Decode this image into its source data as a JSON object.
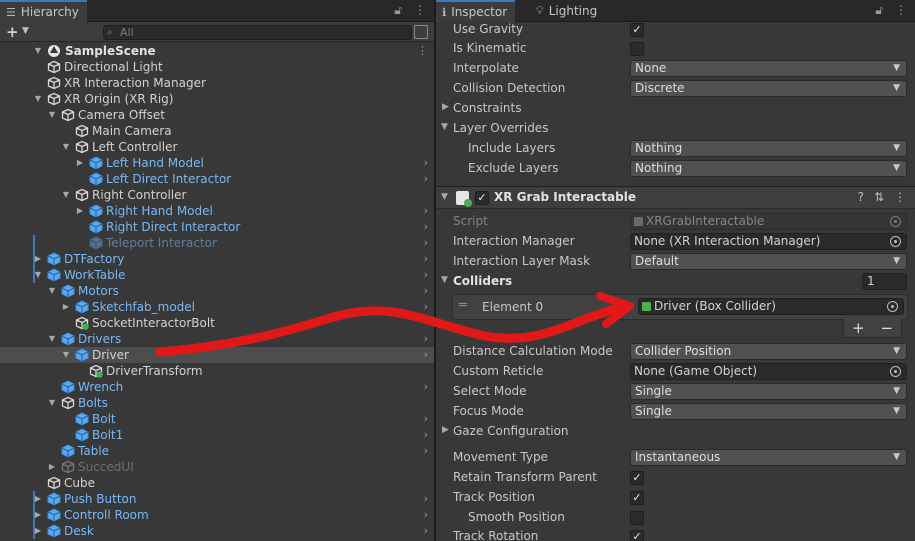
{
  "hierarchy": {
    "tab_label": "Hierarchy",
    "search_placeholder": "All",
    "scene_name": "SampleScene",
    "rows": [
      {
        "label": "Directional Light",
        "color": "white"
      },
      {
        "label": "XR Interaction Manager",
        "color": "white"
      },
      {
        "label": "XR Origin (XR Rig)",
        "color": "white"
      },
      {
        "label": "Camera Offset",
        "color": "white"
      },
      {
        "label": "Main Camera",
        "color": "white"
      },
      {
        "label": "Left Controller",
        "color": "white"
      },
      {
        "label": "Left Hand Model",
        "color": "blue"
      },
      {
        "label": "Left Direct Interactor",
        "color": "blue"
      },
      {
        "label": "Right Controller",
        "color": "white"
      },
      {
        "label": "Right Hand Model",
        "color": "blue"
      },
      {
        "label": "Right Direct Interactor",
        "color": "blue"
      },
      {
        "label": "Teleport Interactor",
        "color": "dim"
      },
      {
        "label": "DTFactory",
        "color": "blue"
      },
      {
        "label": "WorkTable",
        "color": "blue"
      },
      {
        "label": "Motors",
        "color": "blue"
      },
      {
        "label": "Sketchfab_model",
        "color": "blue"
      },
      {
        "label": "SocketInteractorBolt",
        "color": "white"
      },
      {
        "label": "Drivers",
        "color": "blue"
      },
      {
        "label": "Driver",
        "color": "white"
      },
      {
        "label": "DriverTransform",
        "color": "white"
      },
      {
        "label": "Wrench",
        "color": "blue"
      },
      {
        "label": "Bolts",
        "color": "blue"
      },
      {
        "label": "Bolt",
        "color": "blue"
      },
      {
        "label": "Bolt1",
        "color": "blue"
      },
      {
        "label": "Table",
        "color": "blue"
      },
      {
        "label": "SuccedUI",
        "color": "dim"
      },
      {
        "label": "Cube",
        "color": "white"
      },
      {
        "label": "Push Button",
        "color": "blue"
      },
      {
        "label": "Controll Room",
        "color": "blue"
      },
      {
        "label": "Desk",
        "color": "blue"
      }
    ]
  },
  "inspector": {
    "tab_inspector": "Inspector",
    "tab_lighting": "Lighting",
    "rigidbody": {
      "use_gravity": "Use Gravity",
      "is_kinematic": "Is Kinematic",
      "interpolate": "Interpolate",
      "interpolate_value": "None",
      "collision_detection": "Collision Detection",
      "collision_detection_value": "Discrete",
      "constraints": "Constraints",
      "layer_overrides": "Layer Overrides",
      "include_layers": "Include Layers",
      "include_layers_value": "Nothing",
      "exclude_layers": "Exclude Layers",
      "exclude_layers_value": "Nothing"
    },
    "component": {
      "title": "XR Grab Interactable",
      "script": "Script",
      "script_value": "XRGrabInteractable",
      "interaction_manager": "Interaction Manager",
      "interaction_manager_value": "None (XR Interaction Manager)",
      "interaction_layer_mask": "Interaction Layer Mask",
      "interaction_layer_mask_value": "Default",
      "colliders": "Colliders",
      "colliders_size": "1",
      "element0": "Element 0",
      "element0_value": "Driver (Box Collider)",
      "distance_calc": "Distance Calculation Mode",
      "distance_calc_value": "Collider Position",
      "custom_reticle": "Custom Reticle",
      "custom_reticle_value": "None (Game Object)",
      "select_mode": "Select Mode",
      "select_mode_value": "Single",
      "focus_mode": "Focus Mode",
      "focus_mode_value": "Single",
      "gaze_config": "Gaze Configuration",
      "movement_type": "Movement Type",
      "movement_type_value": "Instantaneous",
      "retain_transform": "Retain Transform Parent",
      "track_position": "Track Position",
      "smooth_position": "Smooth Position",
      "track_rotation": "Track Rotation"
    }
  },
  "colors": {
    "accent": "#3a79bb",
    "annotation_arrow": "#e01818",
    "prefab_blue": "#7ab8f5"
  }
}
